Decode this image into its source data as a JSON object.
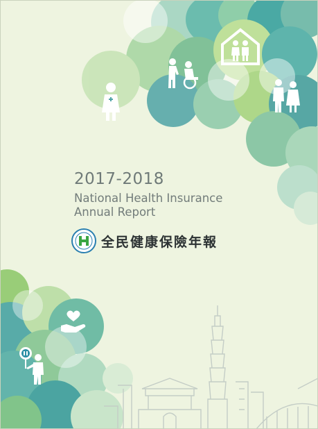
{
  "cover": {
    "years": "2017-2018",
    "title_line1": "National Health Insurance",
    "title_line2": "Annual Report",
    "title_chinese": "全民健康保險年報"
  },
  "icons": {
    "logo": "nhi-emblem-icon",
    "figures": [
      "nurse-icon",
      "caregiver-wheelchair-icon",
      "family-house-icon",
      "elderly-couple-icon",
      "heart-hand-icon",
      "child-with-badge-icon"
    ]
  },
  "colors": {
    "background": "#eef4e0",
    "teal": "#3c9b96",
    "green": "#7cc04b",
    "text_gray": "#6f7a78"
  }
}
